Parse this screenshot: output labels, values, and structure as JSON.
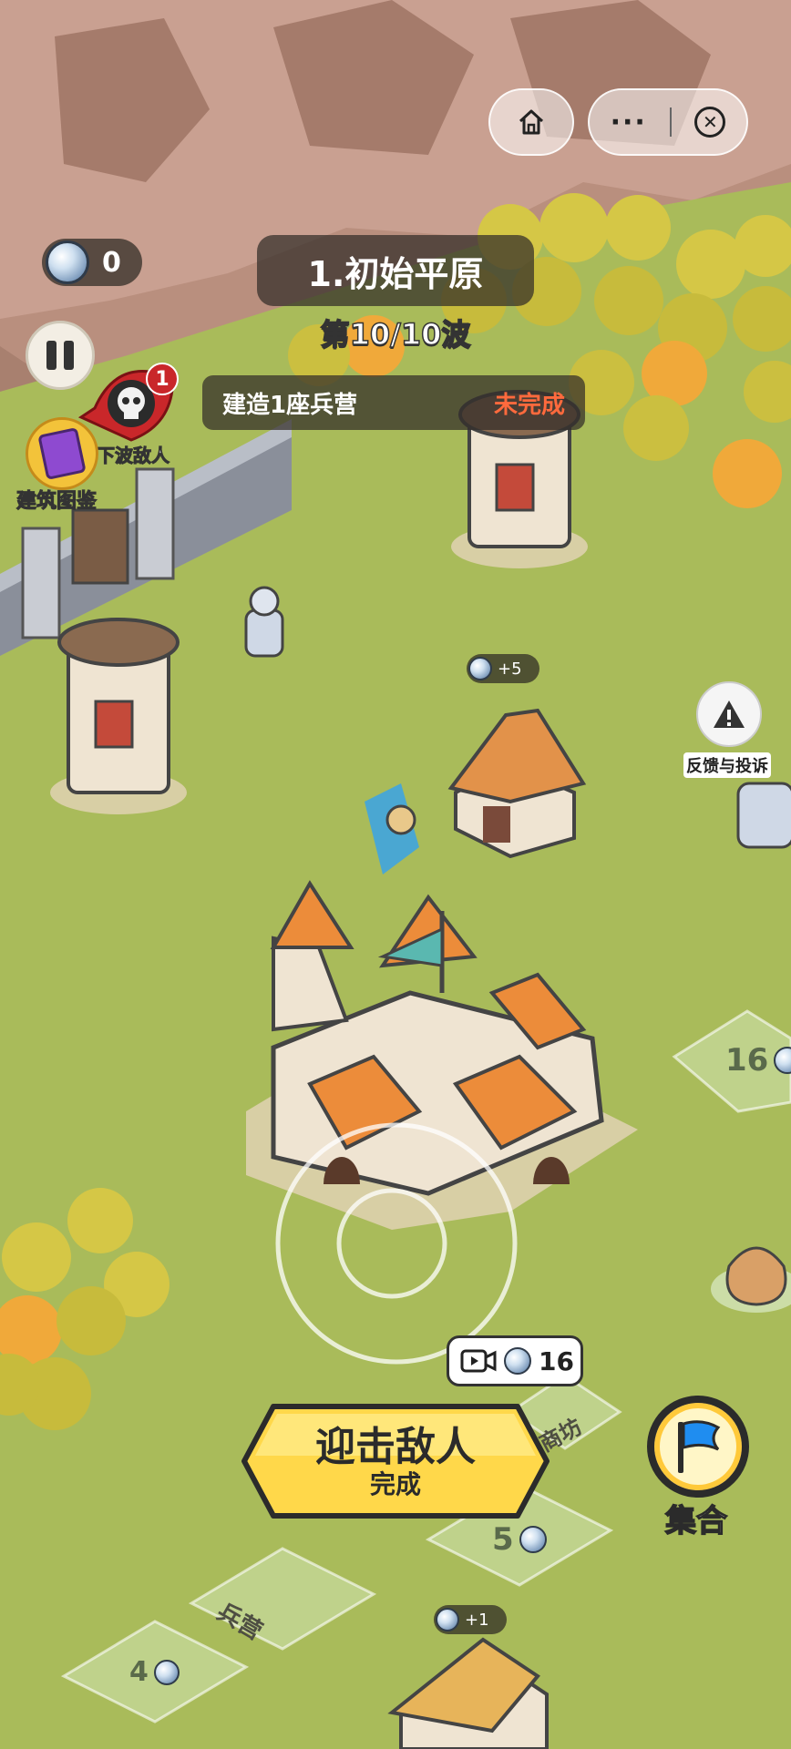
{
  "gems": {
    "count": "0"
  },
  "level": {
    "name": "1.初始平原",
    "wave": "第10/10波"
  },
  "quest": {
    "text": "建造1座兵营",
    "status": "未完成"
  },
  "next_wave": {
    "badge": "1",
    "label": "下波敌人"
  },
  "codex": {
    "label": "建筑图鉴"
  },
  "rewards": {
    "gold_plus5": "+5",
    "gold_plus1": "+1"
  },
  "feedback": {
    "label": "反馈与投诉"
  },
  "plots": {
    "plot16": "16",
    "plot5": "5",
    "plot4": "4",
    "barracks_label": "兵营",
    "shop_label": "商坊"
  },
  "attack": {
    "title": "迎击敌人",
    "subtitle": "完成",
    "video_cost": "16"
  },
  "rally": {
    "label": "集合"
  },
  "colors": {
    "quest_status": "#ff6a3d",
    "button_yellow": "#ffd84a",
    "rally_blue": "#1f8df0"
  }
}
